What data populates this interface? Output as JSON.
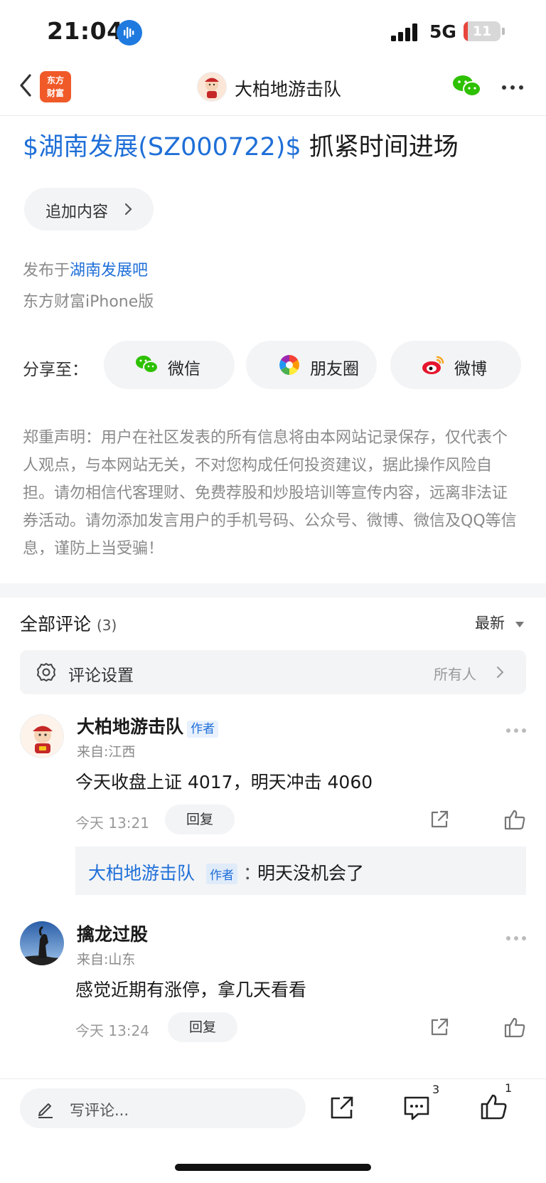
{
  "status_bar": {
    "time": "21:04",
    "network": "5G",
    "battery": "11",
    "battery_fraction": 0.11
  },
  "nav": {
    "app_logo_line1": "东方",
    "app_logo_line2": "财富",
    "title": "大柏地游击队"
  },
  "post": {
    "stock_tag": "$湖南发展(SZ000722)$",
    "title_text": " 抓紧时间进场",
    "append_label": "追加内容",
    "posted_prefix": "发布于",
    "posted_bar": "湖南发展吧",
    "client": "东方财富iPhone版"
  },
  "share": {
    "label": "分享至：",
    "items": [
      {
        "label": "微信",
        "icon": "wechat-icon"
      },
      {
        "label": "朋友圈",
        "icon": "moments-icon"
      },
      {
        "label": "微博",
        "icon": "weibo-icon"
      }
    ]
  },
  "disclaimer": "郑重声明：用户在社区发表的所有信息将由本网站记录保存，仅代表个人观点，与本网站无关，不对您构成任何投资建议，据此操作风险自担。请勿相信代客理财、免费荐股和炒股培训等宣传内容，远离非法证券活动。请勿添加发言用户的手机号码、公众号、微博、微信及QQ等信息，谨防上当受骗！",
  "comments_header": {
    "title": "全部评论",
    "count": "(3)",
    "sort": "最新"
  },
  "comment_settings": {
    "label": "评论设置",
    "value": "所有人"
  },
  "comments": [
    {
      "name": "大柏地游击队",
      "author_tag": "作者",
      "location": "来自:江西",
      "body": "今天收盘上证 4017，明天冲击 4060",
      "time": "今天 13:21",
      "reply_label": "回复",
      "reply": {
        "name": "大柏地游击队",
        "tag": "作者",
        "sep": "：",
        "text": "明天没机会了"
      }
    },
    {
      "name": "擒龙过股",
      "location": "来自:山东",
      "body": "感觉近期有涨停，拿几天看看",
      "time": "今天 13:24",
      "reply_label": "回复"
    }
  ],
  "bottom_bar": {
    "write_placeholder": "写评论...",
    "comment_count": "3",
    "like_count": "1"
  }
}
